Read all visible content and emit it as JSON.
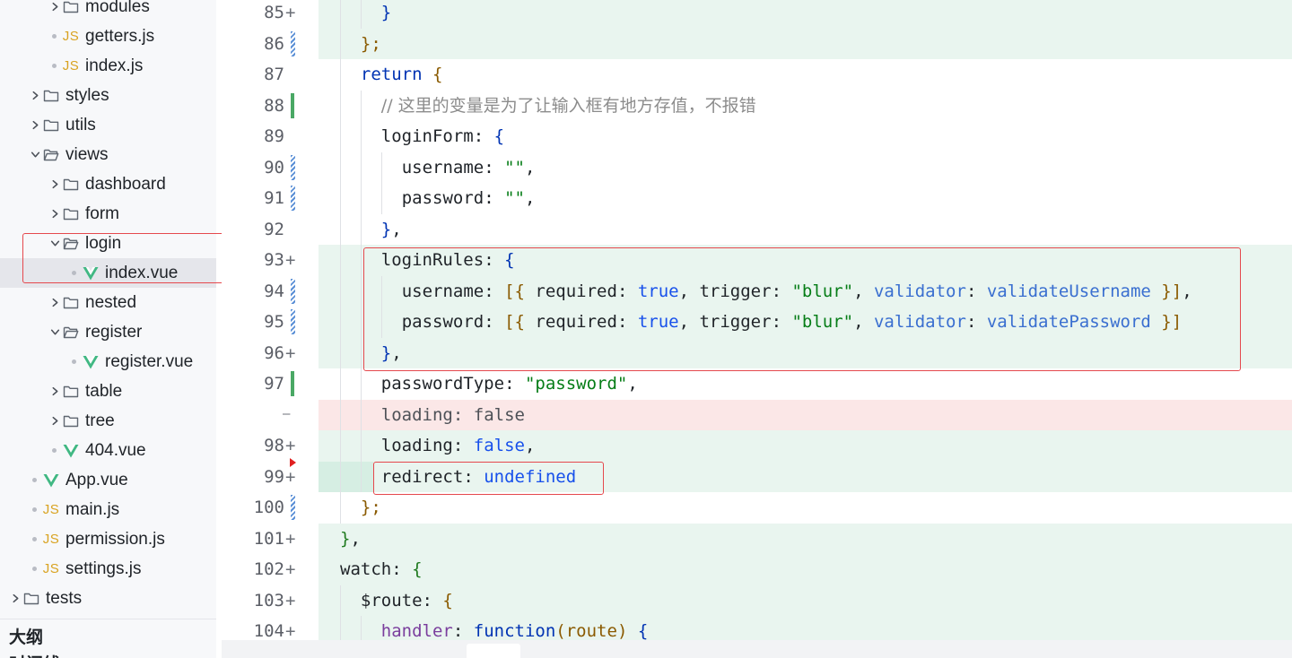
{
  "sidebar": {
    "tree": [
      {
        "label": "modules",
        "icon": "folder-icon",
        "kind": "folder",
        "state": "collapsed"
      },
      {
        "label": "getters.js",
        "icon": "js-file-icon",
        "kind": "file"
      },
      {
        "label": "index.js",
        "icon": "js-file-icon",
        "kind": "file"
      },
      {
        "label": "styles",
        "icon": "folder-icon",
        "kind": "folder",
        "state": "collapsed"
      },
      {
        "label": "utils",
        "icon": "folder-icon",
        "kind": "folder",
        "state": "collapsed"
      },
      {
        "label": "views",
        "icon": "folder-open-icon",
        "kind": "folder",
        "state": "expanded"
      },
      {
        "label": "dashboard",
        "icon": "folder-icon",
        "kind": "folder",
        "state": "collapsed"
      },
      {
        "label": "form",
        "icon": "folder-icon",
        "kind": "folder",
        "state": "collapsed"
      },
      {
        "label": "login",
        "icon": "folder-open-icon",
        "kind": "folder",
        "state": "expanded"
      },
      {
        "label": "index.vue",
        "icon": "vue-file-icon",
        "kind": "file",
        "selected": true
      },
      {
        "label": "nested",
        "icon": "folder-icon",
        "kind": "folder",
        "state": "collapsed"
      },
      {
        "label": "register",
        "icon": "folder-open-icon",
        "kind": "folder",
        "state": "expanded"
      },
      {
        "label": "register.vue",
        "icon": "vue-file-icon",
        "kind": "file"
      },
      {
        "label": "table",
        "icon": "folder-icon",
        "kind": "folder",
        "state": "collapsed"
      },
      {
        "label": "tree",
        "icon": "folder-icon",
        "kind": "folder",
        "state": "collapsed"
      },
      {
        "label": "404.vue",
        "icon": "vue-file-icon",
        "kind": "file"
      },
      {
        "label": "App.vue",
        "icon": "vue-file-icon",
        "kind": "file"
      },
      {
        "label": "main.js",
        "icon": "js-file-icon",
        "kind": "file"
      },
      {
        "label": "permission.js",
        "icon": "js-file-icon",
        "kind": "file"
      },
      {
        "label": "settings.js",
        "icon": "js-file-icon",
        "kind": "file"
      },
      {
        "label": "tests",
        "icon": "folder-icon",
        "kind": "folder",
        "state": "collapsed"
      }
    ],
    "js_badge": "JS",
    "outline_label": "大纲",
    "timeline_label": "时间线"
  },
  "editor": {
    "lines": [
      {
        "num": "85",
        "marker": "plus",
        "tokens": [
          {
            "t": "}",
            "c": "t-b1"
          }
        ]
      },
      {
        "num": "86",
        "marker": "hatch",
        "tokens": [
          {
            "t": "};",
            "c": "t-b3"
          }
        ]
      },
      {
        "num": "87",
        "marker": "none",
        "tokens": [
          {
            "t": "return ",
            "c": "t-kw"
          },
          {
            "t": "{",
            "c": "t-b3"
          }
        ]
      },
      {
        "num": "88",
        "marker": "solid",
        "tokens": [
          {
            "t": "// 这里的变量是为了让输入框有地方存值，不报错",
            "c": "t-cmt"
          }
        ]
      },
      {
        "num": "89",
        "marker": "none",
        "tokens": [
          {
            "t": "loginForm",
            "c": "t-prop"
          },
          {
            "t": ": ",
            "c": ""
          },
          {
            "t": "{",
            "c": "t-b1"
          }
        ]
      },
      {
        "num": "90",
        "marker": "hatch",
        "tokens": [
          {
            "t": "username",
            "c": "t-prop"
          },
          {
            "t": ": ",
            "c": ""
          },
          {
            "t": "\"\"",
            "c": "t-str"
          },
          {
            "t": ",",
            "c": ""
          }
        ]
      },
      {
        "num": "91",
        "marker": "hatch",
        "tokens": [
          {
            "t": "password",
            "c": "t-prop"
          },
          {
            "t": ": ",
            "c": ""
          },
          {
            "t": "\"\"",
            "c": "t-str"
          },
          {
            "t": ",",
            "c": ""
          }
        ]
      },
      {
        "num": "92",
        "marker": "none",
        "tokens": [
          {
            "t": "}",
            "c": "t-b1"
          },
          {
            "t": ",",
            "c": ""
          }
        ]
      },
      {
        "num": "93",
        "marker": "plus",
        "tokens": [
          {
            "t": "loginRules",
            "c": "t-prop"
          },
          {
            "t": ": ",
            "c": ""
          },
          {
            "t": "{",
            "c": "t-b1"
          }
        ]
      },
      {
        "num": "94",
        "marker": "hatch",
        "tokens": [
          {
            "t": "username",
            "c": "t-prop"
          },
          {
            "t": ": ",
            "c": ""
          },
          {
            "t": "[{",
            "c": "t-b3"
          },
          {
            "t": " required",
            "c": "t-prop"
          },
          {
            "t": ": ",
            "c": ""
          },
          {
            "t": "true",
            "c": "t-kw2"
          },
          {
            "t": ", ",
            "c": ""
          },
          {
            "t": "trigger",
            "c": "t-prop"
          },
          {
            "t": ": ",
            "c": ""
          },
          {
            "t": "\"blur\"",
            "c": "t-str"
          },
          {
            "t": ", ",
            "c": ""
          },
          {
            "t": "validator",
            "c": "t-id"
          },
          {
            "t": ": ",
            "c": ""
          },
          {
            "t": "validateUsername",
            "c": "t-id"
          },
          {
            "t": " }]",
            "c": "t-b3"
          },
          {
            "t": ",",
            "c": ""
          }
        ]
      },
      {
        "num": "95",
        "marker": "hatch",
        "tokens": [
          {
            "t": "password",
            "c": "t-prop"
          },
          {
            "t": ": ",
            "c": ""
          },
          {
            "t": "[{",
            "c": "t-b3"
          },
          {
            "t": " required",
            "c": "t-prop"
          },
          {
            "t": ": ",
            "c": ""
          },
          {
            "t": "true",
            "c": "t-kw2"
          },
          {
            "t": ", ",
            "c": ""
          },
          {
            "t": "trigger",
            "c": "t-prop"
          },
          {
            "t": ": ",
            "c": ""
          },
          {
            "t": "\"blur\"",
            "c": "t-str"
          },
          {
            "t": ", ",
            "c": ""
          },
          {
            "t": "validator",
            "c": "t-id"
          },
          {
            "t": ": ",
            "c": ""
          },
          {
            "t": "validatePassword",
            "c": "t-id"
          },
          {
            "t": " }]",
            "c": "t-b3"
          }
        ]
      },
      {
        "num": "96",
        "marker": "plus",
        "tokens": [
          {
            "t": "}",
            "c": "t-b1"
          },
          {
            "t": ",",
            "c": ""
          }
        ]
      },
      {
        "num": "97",
        "marker": "solid",
        "tokens": [
          {
            "t": "passwordType",
            "c": "t-prop"
          },
          {
            "t": ": ",
            "c": ""
          },
          {
            "t": "\"password\"",
            "c": "t-str"
          },
          {
            "t": ",",
            "c": ""
          }
        ]
      },
      {
        "num": "",
        "marker": "minus",
        "tokens": [
          {
            "t": "loading",
            "c": "t-del"
          },
          {
            "t": ": ",
            "c": "t-del"
          },
          {
            "t": "false",
            "c": "t-del"
          }
        ]
      },
      {
        "num": "98",
        "marker": "plus",
        "tokens": [
          {
            "t": "loading",
            "c": "t-prop"
          },
          {
            "t": ": ",
            "c": ""
          },
          {
            "t": "false",
            "c": "t-kw2"
          },
          {
            "t": ",",
            "c": ""
          }
        ]
      },
      {
        "num": "99",
        "marker": "plus",
        "tokens": [
          {
            "t": "redirect",
            "c": "t-prop"
          },
          {
            "t": ": ",
            "c": ""
          },
          {
            "t": "undefined",
            "c": "t-kw2"
          }
        ]
      },
      {
        "num": "100",
        "marker": "hatch",
        "tokens": [
          {
            "t": "};",
            "c": "t-b3"
          }
        ]
      },
      {
        "num": "101",
        "marker": "plus",
        "tokens": [
          {
            "t": "}",
            "c": "t-b2"
          },
          {
            "t": ",",
            "c": ""
          }
        ]
      },
      {
        "num": "102",
        "marker": "plus",
        "tokens": [
          {
            "t": "watch",
            "c": "t-prop"
          },
          {
            "t": ": ",
            "c": ""
          },
          {
            "t": "{",
            "c": "t-b2"
          }
        ]
      },
      {
        "num": "103",
        "marker": "plus",
        "tokens": [
          {
            "t": "$route",
            "c": "t-prop"
          },
          {
            "t": ": ",
            "c": ""
          },
          {
            "t": "{",
            "c": "t-b3"
          }
        ]
      },
      {
        "num": "104",
        "marker": "plus",
        "tokens": [
          {
            "t": "handler",
            "c": "t-fn"
          },
          {
            "t": ": ",
            "c": ""
          },
          {
            "t": "function",
            "c": "t-kw"
          },
          {
            "t": "(",
            "c": "t-b3"
          },
          {
            "t": "route",
            "c": "t-b3"
          },
          {
            "t": ") ",
            "c": "t-b3"
          },
          {
            "t": "{",
            "c": "t-b1"
          }
        ]
      }
    ]
  },
  "colors": {
    "diff_added": "#e9f5ef",
    "diff_removed": "#fbe7e7",
    "gutter_modified": "#4aa865",
    "highlight_box": "#e5484d"
  }
}
